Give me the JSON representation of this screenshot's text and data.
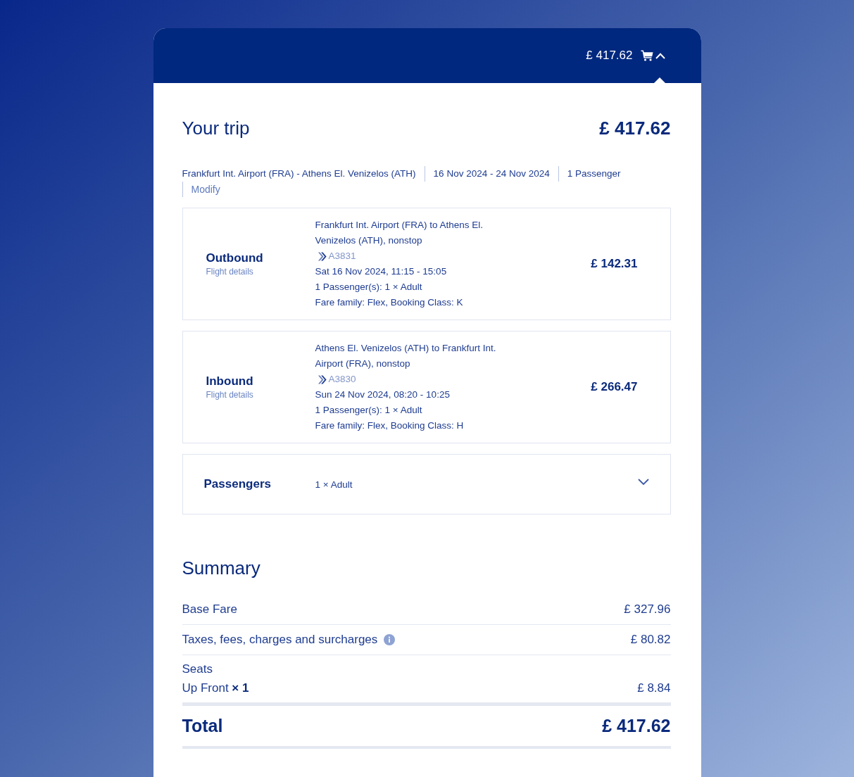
{
  "header": {
    "total": "£ 417.62",
    "expanded": true
  },
  "trip": {
    "title": "Your trip",
    "total": "£ 417.62",
    "route": "Frankfurt Int. Airport (FRA) - Athens El. Venizelos (ATH)",
    "dates": "16 Nov 2024 - 24 Nov 2024",
    "passengers": "1 Passenger",
    "modify": "Modify"
  },
  "flights": [
    {
      "direction": "Outbound",
      "details_link": "Flight details",
      "route": "Frankfurt Int. Airport (FRA) to Athens El. Venizelos (ATH), nonstop",
      "flight_number": "A3831",
      "schedule": "Sat 16 Nov 2024, 11:15 - 15:05",
      "passengers": "1 Passenger(s): 1 × Adult",
      "fare": "Fare family: Flex, Booking Class: K",
      "price": "£ 142.31"
    },
    {
      "direction": "Inbound",
      "details_link": "Flight details",
      "route": "Athens El. Venizelos (ATH) to Frankfurt Int. Airport (FRA), nonstop",
      "flight_number": "A3830",
      "schedule": "Sun 24 Nov 2024, 08:20 - 10:25",
      "passengers": "1 Passenger(s): 1 × Adult",
      "fare": "Fare family: Flex, Booking Class: H",
      "price": "£ 266.47"
    }
  ],
  "passengers_panel": {
    "title": "Passengers",
    "summary": "1 × Adult",
    "expanded": false
  },
  "summary": {
    "title": "Summary",
    "rows": [
      {
        "kind": "plain",
        "label": "Base Fare",
        "amount": "£ 327.96"
      },
      {
        "kind": "info",
        "label": "Taxes, fees, charges and surcharges",
        "amount": "£ 80.82"
      },
      {
        "kind": "group",
        "label": "Seats",
        "items": [
          {
            "label": "Up Front **× 1**",
            "amount": "£ 8.84"
          }
        ]
      }
    ],
    "total_label": "Total",
    "total": "£ 417.62"
  }
}
